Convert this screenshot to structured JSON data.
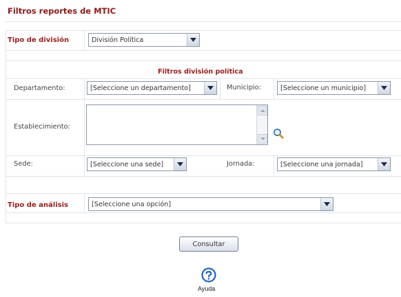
{
  "header": {
    "title": "Filtros reportes de MTIC"
  },
  "division": {
    "label": "Tipo de división",
    "selected": "División Política"
  },
  "filters": {
    "section_title": "Filtros división política",
    "departamento": {
      "label": "Departamento:",
      "selected": "[Seleccione un departamento]"
    },
    "municipio": {
      "label": "Municipio:",
      "selected": "[Seleccione un municipio]"
    },
    "establecimiento": {
      "label": "Establecimiento:",
      "value": ""
    },
    "sede": {
      "label": "Sede:",
      "selected": "[Seleccione una sede]"
    },
    "jornada": {
      "label": "Jornada:",
      "selected": "[Seleccione una jornada]"
    }
  },
  "analysis": {
    "label": "Tipo de análisis",
    "selected": "[Seleccione una opción]"
  },
  "actions": {
    "submit_label": "Consultar"
  },
  "help": {
    "label": "Ayuda",
    "icon": "question-circle-icon"
  },
  "colors": {
    "title": "#8b1a1a",
    "accent_red": "#9a1c1c",
    "border": "#dfe4ea",
    "help_blue": "#1e63c6"
  }
}
